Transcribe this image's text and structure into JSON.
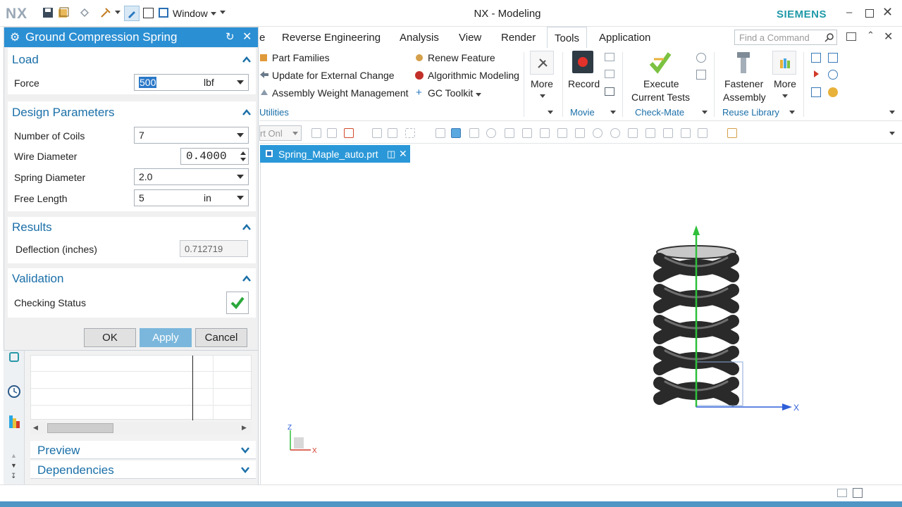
{
  "app": {
    "logo": "NX",
    "window_menu": "Window",
    "title": "NX - Modeling",
    "brand": "SIEMENS"
  },
  "menubar": {
    "tabs": [
      {
        "label": "e"
      },
      {
        "label": "Reverse Engineering"
      },
      {
        "label": "Analysis"
      },
      {
        "label": "View"
      },
      {
        "label": "Render"
      },
      {
        "label": "Tools"
      },
      {
        "label": "Application"
      }
    ],
    "active_tab": "Tools",
    "search_placeholder": "Find a Command"
  },
  "ribbon": {
    "utilities": {
      "items": [
        "Part Families",
        "Update for External Change",
        "Assembly Weight Management",
        "Renew Feature",
        "Algorithmic Modeling",
        "GC Toolkit"
      ],
      "group_label": "Utilities"
    },
    "more1_label": "More",
    "record_label": "Record",
    "movie_label": "Movie",
    "execute_label_1": "Execute",
    "execute_label_2": "Current Tests",
    "checkmate_label": "Check-Mate",
    "fastener_label_1": "Fastener",
    "fastener_label_2": "Assembly",
    "more2_label": "More",
    "reuse_label": "Reuse Library"
  },
  "toolbar2": {
    "filter_value": "rt Onl"
  },
  "document": {
    "tab_label": "Spring_Maple_auto.prt"
  },
  "triad": {
    "z_label": "Z",
    "x_label": "X",
    "axis_x_label": "X"
  },
  "dialog": {
    "title": "Ground Compression Spring",
    "sections": {
      "load": "Load",
      "design": "Design Parameters",
      "results": "Results",
      "validation": "Validation"
    },
    "fields": {
      "force_label": "Force",
      "force_value": "500",
      "force_unit": "lbf",
      "coils_label": "Number of Coils",
      "coils_value": "7",
      "wire_label": "Wire Diameter",
      "wire_value": "0.4000",
      "spring_label": "Spring Diameter",
      "spring_value": "2.0",
      "free_label": "Free Length",
      "free_value": "5",
      "free_unit": "in",
      "deflection_label": "Deflection (inches)",
      "deflection_value": "0.712719",
      "status_label": "Checking Status"
    },
    "buttons": {
      "ok": "OK",
      "apply": "Apply",
      "cancel": "Cancel"
    }
  },
  "lower_panel": {
    "preview": "Preview",
    "dependencies": "Dependencies"
  },
  "colors": {
    "accent": "#2b8fd3",
    "section_text": "#1a6fa8",
    "siemens": "#1f9aa8"
  }
}
